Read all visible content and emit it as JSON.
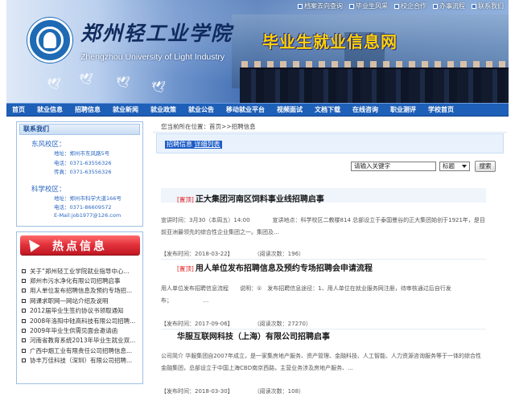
{
  "header": {
    "school_name_cn": "郑州轻工业学院",
    "school_name_en": "Zhengzhou University of Light Industry",
    "site_title": "毕业生就业信息网",
    "quick_links": [
      {
        "label": "档案去向查询",
        "icon": "square-icon"
      },
      {
        "label": "毕业生风采",
        "icon": "square-icon"
      },
      {
        "label": "校企合作",
        "icon": "square-icon"
      },
      {
        "label": "办事流程",
        "icon": "square-icon"
      },
      {
        "label": "联系我们",
        "icon": "square-icon"
      }
    ]
  },
  "nav": {
    "items": [
      {
        "label": "首页"
      },
      {
        "label": "就业信息"
      },
      {
        "label": "招聘信息"
      },
      {
        "label": "就业新闻"
      },
      {
        "label": "就业政策"
      },
      {
        "label": "就业公告"
      },
      {
        "label": "移动就业平台"
      },
      {
        "label": "视频面试"
      },
      {
        "label": "文档下载"
      },
      {
        "label": "在线咨询"
      },
      {
        "label": "职业测评"
      },
      {
        "label": "学校首页"
      }
    ]
  },
  "contact": {
    "title": "联系我们",
    "campuses": [
      {
        "name": "东风校区：",
        "lines": [
          "地址：郑州市东风路5号",
          "电话：0371-63556326",
          "传真：0371-63556326"
        ]
      },
      {
        "name": "科学校区：",
        "lines": [
          "地址：郑州市科学大道166号",
          "电话：0371-86609572",
          "E-Mail:job1977@126.com"
        ]
      }
    ]
  },
  "hot": {
    "title": "热点信息",
    "items": [
      "关于“郑州轻工业学院就业指导中心...",
      "郑州市污水净化有限公司招聘启事",
      "用人单位发布招聘信息及预约专场招...",
      "网课求职网一网站介绍及说明",
      "2012届毕业生签约协议书领取通知",
      "2008年洛阳中硅高科技有限公司招聘...",
      "2009年毕业生供需见面会邀请函",
      "河南省教育系统2013年毕业生就业双...",
      "广西中烟工业有限责任公司招聘信息...",
      "协丰万佳科技（深圳）有限公司招聘..."
    ]
  },
  "main": {
    "breadcrumb": "您当前所在位置：首页>>招聘信息",
    "tab_label": "招聘信息",
    "tab_more": "详细列表",
    "search": {
      "placeholder": "请输入关键字",
      "select_value": "标题",
      "button": "搜索"
    },
    "articles": [
      {
        "tag": "[置顶]",
        "title": "正大集团河南区饲料事业线招聘启事",
        "summary": "宣讲时间：3月30（本周五）14:00　　　　宣讲地点：科学校区二教楼814 总部设立于泰国曼谷的正大集团始创于1921年，是目前亚洲最领先的综合性企业集团之一。集团及...",
        "published": "【发布时间：2018-03-22】",
        "views": "（阅读次数：196）"
      },
      {
        "tag": "[置顶]",
        "title": "用人单位发布招聘信息及预约专场招聘会申请流程",
        "summary": "用人单位发布招聘信息流程　　说明：①　发布招聘信息途径：1、用人单位在就业服务网注册，待审核通过后自行发布；　　　　　　...",
        "published": "【发布时间：2017-09-06】",
        "views": "（阅读次数：27270）"
      },
      {
        "tag": "",
        "title": "华服互联网科技（上海）有限公司招聘启事",
        "summary": "公司简介 华服集团自2007年成立，是一家集房地产服务、资产管理、金融科技、人工智能、人力资源咨询服务等于一体的综合性金融集团，总部设立于中国上海CBD南京西路，主营业务涉及房地产服务、...",
        "published": "【发布时间：2018-03-30】",
        "views": "（阅读次数：108）"
      }
    ]
  },
  "colors": {
    "nav_bg": "#1e5fb8",
    "site_title": "#ffd400",
    "hot_red": "#e0303a",
    "link_blue": "#2a66c2",
    "top_tag_red": "#e02020"
  }
}
